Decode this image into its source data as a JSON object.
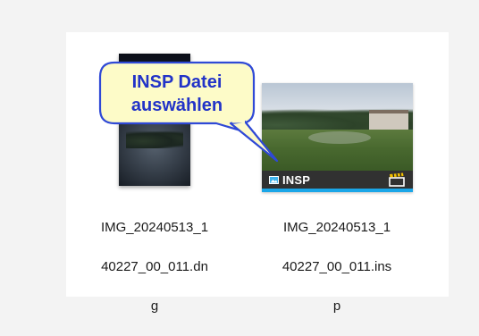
{
  "files": [
    {
      "name_line1": "IMG_20240513_1",
      "name_line2": "40227_00_011.dn",
      "name_line3": "g",
      "thumbnail_icon": "image-thumbnail"
    },
    {
      "name_line1": "IMG_20240513_1",
      "name_line2": "40227_00_011.ins",
      "name_line3": "p",
      "thumbnail_icon": "panorama-thumbnail",
      "badge_label": "INSP",
      "badge_icon": "image-icon",
      "corner_icon": "clapperboard-icon"
    }
  ],
  "callout": {
    "line1": "INSP Datei",
    "line2": "auswählen"
  },
  "colors": {
    "callout_fill": "#fdfbc8",
    "callout_border": "#2f49d6",
    "callout_text": "#2233c8",
    "accent": "#1aa6e8"
  }
}
